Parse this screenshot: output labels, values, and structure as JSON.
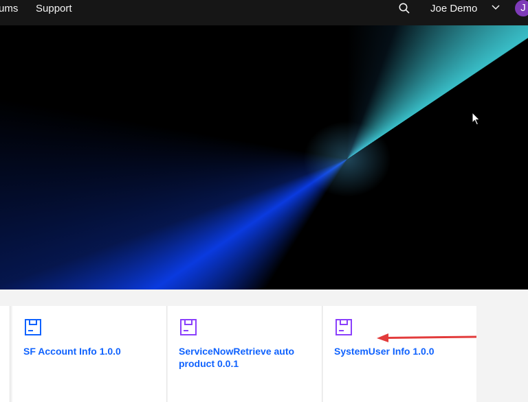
{
  "nav": {
    "forums_label": "ums",
    "support_label": "Support",
    "search_icon": "search-icon",
    "user_name": "Joe Demo",
    "avatar_initial": "J",
    "dropdown_icon": "chevron-down-icon"
  },
  "cards": [
    {
      "title": "SF Account Info 1.0.0",
      "icon": "package-icon",
      "icon_color": "#0f62fe"
    },
    {
      "title": "ServiceNowRetrieve auto product 0.0.1",
      "icon": "package-icon",
      "icon_color": "#8a3ffc"
    },
    {
      "title": "SystemUser Info 1.0.0",
      "icon": "package-icon",
      "icon_color": "#8a3ffc"
    }
  ],
  "colors": {
    "nav_bg": "#161616",
    "link_blue": "#0f62fe",
    "purple": "#8a3ffc",
    "annotation_red": "#e23b3b"
  }
}
